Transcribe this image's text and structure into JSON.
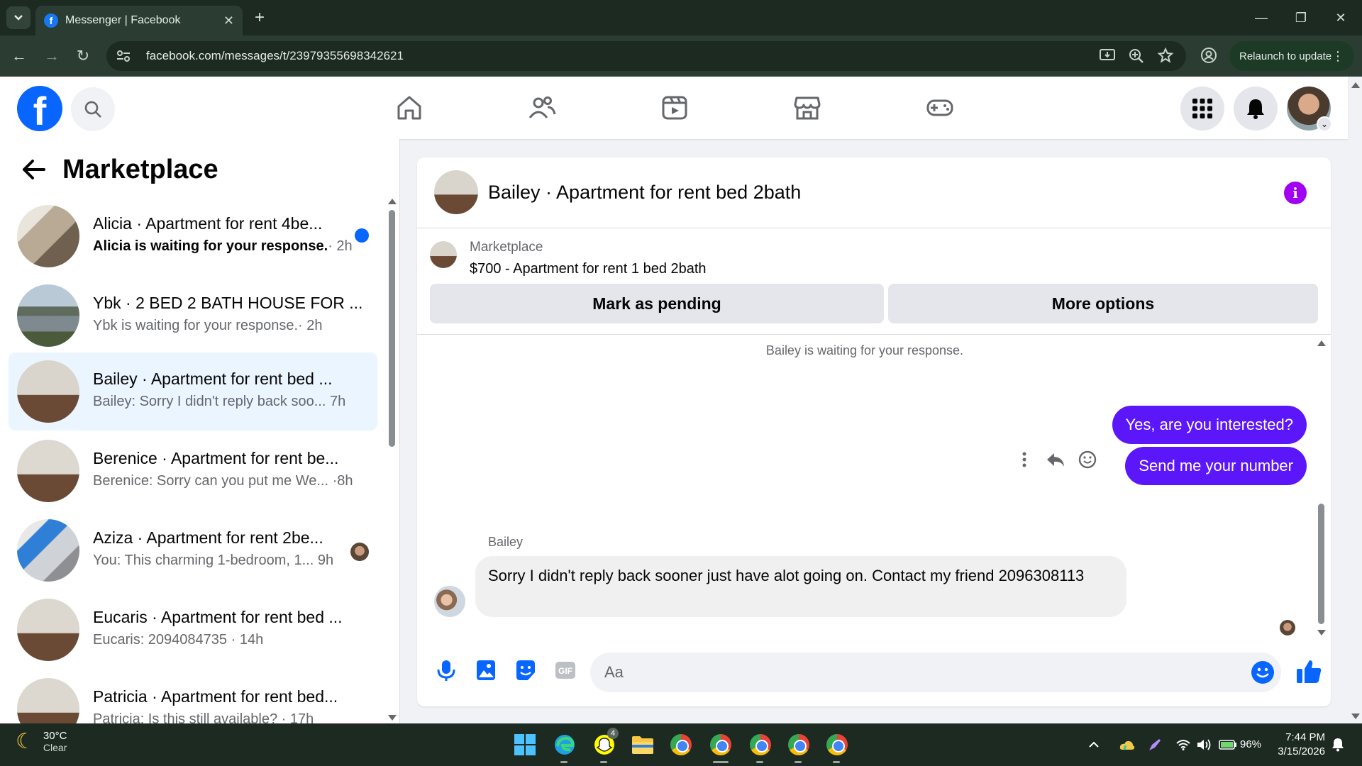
{
  "browser": {
    "tab_title": "Messenger | Facebook",
    "url": "facebook.com/messages/t/23979355698342621",
    "relaunch_label": "Relaunch to update"
  },
  "fb": {
    "search_icon": "search-icon",
    "nav_icons": [
      "home-icon",
      "friends-icon",
      "video-icon",
      "marketplace-icon",
      "gaming-icon"
    ],
    "accent_color": "#0866ff"
  },
  "sidebar": {
    "title": "Marketplace",
    "conversations": [
      {
        "name": "Alicia · Apartment for rent 4be...",
        "snippet": "Alicia is waiting for your response.",
        "time": "· 2h",
        "unread": true
      },
      {
        "name": "Ybk · 2 BED 2 BATH HOUSE FOR ...",
        "snippet": "Ybk is waiting for your response.",
        "time": "· 2h",
        "unread": false
      },
      {
        "name": "Bailey · Apartment for rent bed ...",
        "snippet": "Bailey: Sorry I didn't reply back soo...",
        "time": " 7h",
        "unread": false
      },
      {
        "name": "Berenice · Apartment for rent be...",
        "snippet": "Berenice: Sorry can you put me We...",
        "time": " ·8h",
        "unread": false
      },
      {
        "name": "Aziza · Apartment for rent 2be...",
        "snippet": "You: This charming 1-bedroom, 1...",
        "time": " 9h",
        "unread": false
      },
      {
        "name": "Eucaris · Apartment for rent bed ...",
        "snippet": "Eucaris: 2094084735",
        "time": " · 14h",
        "unread": false
      },
      {
        "name": "Patricia · Apartment for rent bed...",
        "snippet": "Patricia: Is this still available?",
        "time": " · 17h",
        "unread": false
      }
    ]
  },
  "chat": {
    "title": "Bailey · Apartment for rent bed 2bath",
    "listing_label": "Marketplace",
    "listing_price": "$700 - Apartment for rent 1 bed 2bath",
    "mark_pending": "Mark as pending",
    "more_options": "More options",
    "waiting": "Bailey is waiting for your response.",
    "outgoing": [
      "Yes, are you interested?",
      "Send me your number"
    ],
    "sender": "Bailey",
    "incoming": "Sorry I didn't reply back sooner just have alot going on. Contact my friend 2096308113",
    "input_placeholder": "Aa",
    "bubble_color": "#5b17fa"
  },
  "taskbar": {
    "temp": "30°C",
    "weather": "Clear",
    "battery": "96%",
    "time": "7:44 PM",
    "date": "3/15/2026",
    "snap_badge": "4"
  }
}
